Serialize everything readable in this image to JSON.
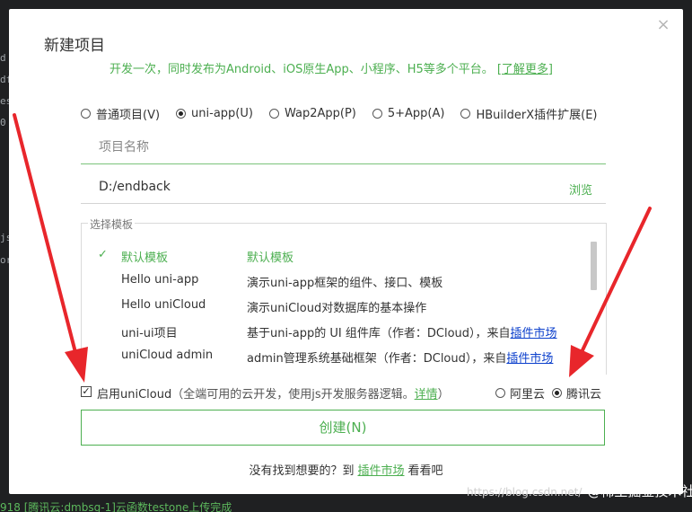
{
  "background": {
    "left_snippets": [
      "d",
      "df",
      "es",
      "0",
      "js",
      "or"
    ],
    "bottom_log": "918 [腾讯云:dmbsg-1]云函数testone上传完成",
    "watermark_small": "https://blog.csdn.net/",
    "watermark_big": "@稀土掘金技术社区"
  },
  "dialog": {
    "title": "新建项目",
    "subtitle": "开发一次，同时发布为Android、iOS原生App、小程序、H5等多个平台。",
    "learn_more": "[了解更多]",
    "close_glyph": "×"
  },
  "project_types": [
    {
      "label": "普通项目(V)",
      "selected": false
    },
    {
      "label": "uni-app(U)",
      "selected": true
    },
    {
      "label": "Wap2App(P)",
      "selected": false
    },
    {
      "label": "5+App(A)",
      "selected": false
    },
    {
      "label": "HBuilderX插件扩展(E)",
      "selected": false
    }
  ],
  "name_field": {
    "placeholder": "项目名称",
    "value": ""
  },
  "path_field": {
    "value": "D:/endback",
    "browse_label": "浏览"
  },
  "templates": {
    "legend": "选择模板",
    "rows": [
      {
        "name": "默认模板",
        "desc": "默认模板",
        "link": "",
        "selected": true
      },
      {
        "name": "Hello uni-app",
        "desc": "演示uni-app框架的组件、接口、模板",
        "link": "",
        "selected": false
      },
      {
        "name": "Hello uniCloud",
        "desc": "演示uniCloud对数据库的基本操作",
        "link": "",
        "selected": false
      },
      {
        "name": "uni-ui项目",
        "desc": "基于uni-app的 UI 组件库（作者：DCloud），来自",
        "link": "插件市场",
        "selected": false
      },
      {
        "name": "uniCloud admin",
        "desc": "admin管理系统基础框架（作者：DCloud），来自",
        "link": "插件市场",
        "selected": false
      }
    ]
  },
  "cloud": {
    "enabled": true,
    "label": "启用uniCloud",
    "note": "（全端可用的云开发，使用js开发服务器逻辑。",
    "details": "详情",
    "note_end": "）",
    "providers": [
      {
        "label": "阿里云",
        "selected": false
      },
      {
        "label": "腾讯云",
        "selected": true
      }
    ]
  },
  "create_label": "创建(N)",
  "footer": {
    "prefix": "没有找到想要的？到",
    "link": "插件市场",
    "suffix": "看看吧"
  },
  "colors": {
    "accent": "#4caf50",
    "arrow": "#e8262b",
    "link_blue": "#0b3fcc"
  }
}
